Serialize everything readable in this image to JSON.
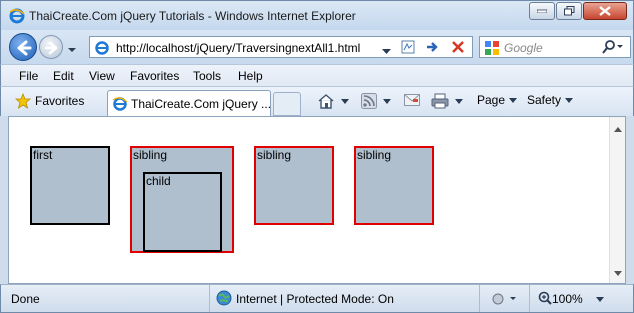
{
  "window": {
    "title": "ThaiCreate.Com jQuery Tutorials - Windows Internet Explorer"
  },
  "navigation": {
    "url": "http://localhost/jQuery/TraversingnextAll1.html",
    "search_placeholder": "Google"
  },
  "menu": {
    "items": [
      "File",
      "Edit",
      "View",
      "Favorites",
      "Tools",
      "Help"
    ]
  },
  "favorites_bar": {
    "favorites_label": "Favorites",
    "tab_title": "ThaiCreate.Com jQuery ...",
    "commands": {
      "page_label": "Page",
      "safety_label": "Safety"
    }
  },
  "page": {
    "boxes": [
      {
        "label": "first",
        "border": "black"
      },
      {
        "label": "sibling",
        "border": "red"
      },
      {
        "label": "child",
        "border": "black"
      },
      {
        "label": "sibling",
        "border": "red"
      },
      {
        "label": "sibling",
        "border": "red"
      }
    ],
    "box_fill": "#b0bfce"
  },
  "status": {
    "left_text": "Done",
    "zone_text": "Internet | Protected Mode: On",
    "zoom": "100%"
  },
  "colors": {
    "accent": "#1d5fb8",
    "red_border": "#e00000"
  }
}
